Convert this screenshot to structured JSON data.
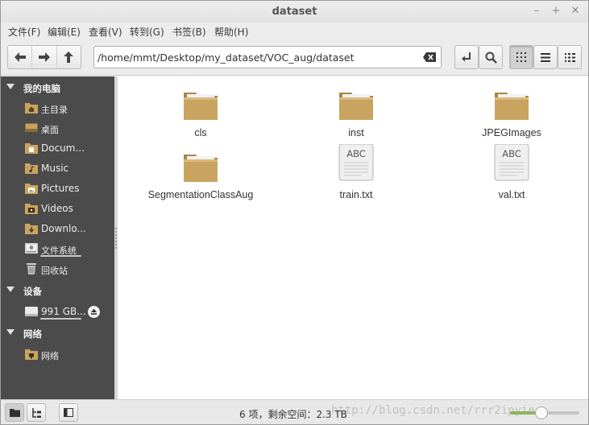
{
  "window": {
    "title": "dataset"
  },
  "menu": [
    "文件(F)",
    "编辑(E)",
    "查看(V)",
    "转到(G)",
    "书签(B)",
    "帮助(H)"
  ],
  "location": {
    "path": "/home/mmt/Desktop/my_dataset/VOC_aug/dataset"
  },
  "sidebar": {
    "sections": [
      {
        "label": "我的电脑",
        "items": [
          {
            "label": "主目录",
            "icon": "home-folder-icon"
          },
          {
            "label": "桌面",
            "icon": "desktop-icon"
          },
          {
            "label": "Docum...",
            "icon": "documents-folder-icon"
          },
          {
            "label": "Music",
            "icon": "music-folder-icon"
          },
          {
            "label": "Pictures",
            "icon": "pictures-folder-icon"
          },
          {
            "label": "Videos",
            "icon": "videos-folder-icon"
          },
          {
            "label": "Downlo...",
            "icon": "downloads-folder-icon"
          },
          {
            "label": "文件系统",
            "icon": "filesystem-icon"
          },
          {
            "label": "回收站",
            "icon": "trash-icon"
          }
        ]
      },
      {
        "label": "设备",
        "items": [
          {
            "label": "991 GB...",
            "icon": "drive-icon"
          }
        ]
      },
      {
        "label": "网络",
        "items": [
          {
            "label": "网络",
            "icon": "network-icon"
          }
        ]
      }
    ]
  },
  "files": [
    {
      "name": "cls",
      "type": "folder"
    },
    {
      "name": "inst",
      "type": "folder"
    },
    {
      "name": "JPEGImages",
      "type": "folder"
    },
    {
      "name": "SegmentationClassAug",
      "type": "folder"
    },
    {
      "name": "train.txt",
      "type": "text",
      "badge": "ABC"
    },
    {
      "name": "val.txt",
      "type": "text",
      "badge": "ABC"
    }
  ],
  "status": {
    "text": "6 项，剩余空间：2.3 TB",
    "watermark": "http://blog.csdn.net/rrr2ipyie",
    "zoom_fraction": 0.45
  },
  "colors": {
    "folder": "#c9a461",
    "sidebar_bg": "#4b4b4b",
    "slider_fill": "#8fb55a"
  }
}
